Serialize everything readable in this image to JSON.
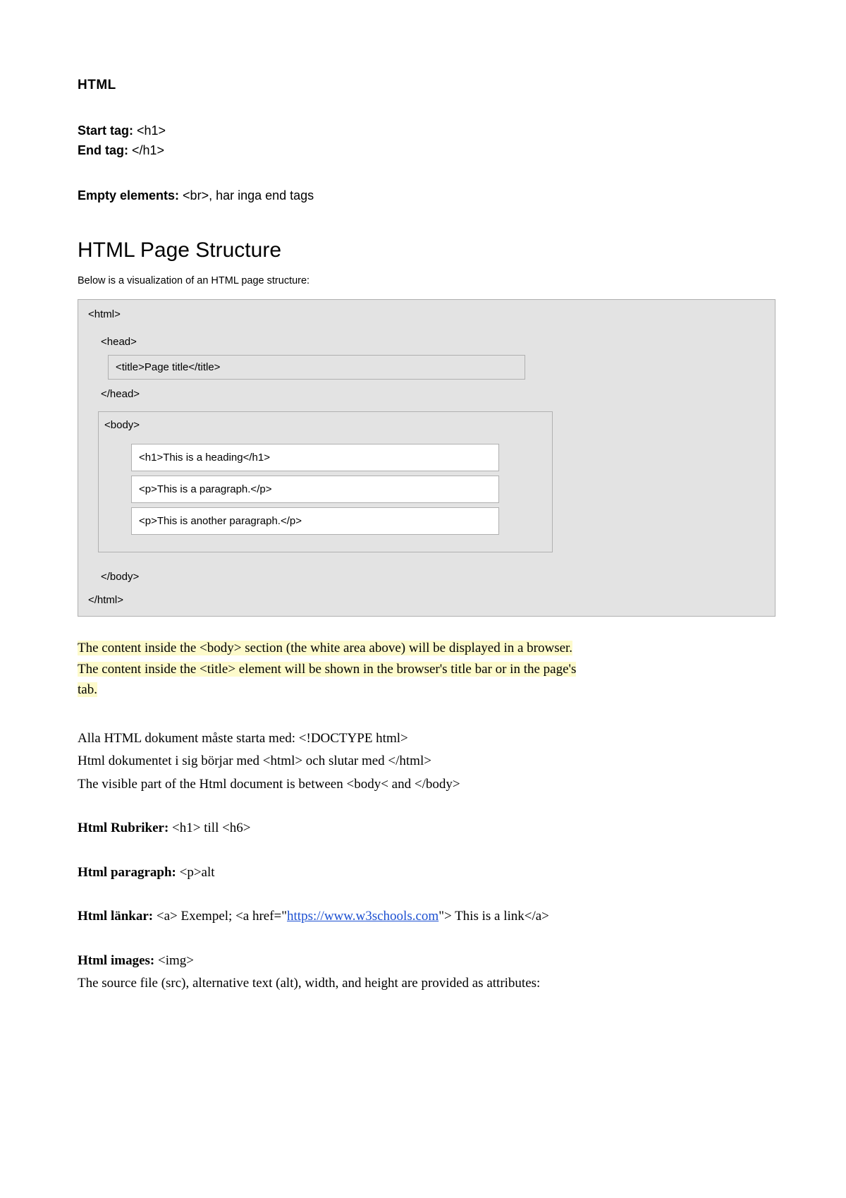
{
  "title": "HTML",
  "startTagLabel": "Start tag:",
  "startTagVal": " <h1>",
  "endTagLabel": "End tag:",
  "endTagVal": " </h1>",
  "emptyLabel": "Empty elements:",
  "emptyVal": " <br>, har inga end tags",
  "sectionTitle": "HTML Page Structure",
  "sectionSub": "Below is a visualization of an HTML page structure:",
  "struct": {
    "htmlOpen": "<html>",
    "headOpen": "<head>",
    "titleTag": "<title>Page title</title>",
    "headClose": "</head>",
    "bodyOpen": "<body>",
    "h1": "<h1>This is a heading</h1>",
    "p1": "<p>This is a paragraph.</p>",
    "p2": "<p>This is another paragraph.</p>",
    "bodyClose": "</body>",
    "htmlClose": "</html>"
  },
  "highlight1": "The content inside the <body> section (the white area above) will be displayed in a browser.",
  "highlight2a": "The content inside the <title> element will be shown in the browser's title bar or in the page's",
  "highlight2b": "tab.",
  "para1": "Alla HTML dokument måste starta med: <!DOCTYPE html>",
  "para2": "Html dokumentet i sig börjar med <html> och slutar med </html>",
  "para3": "The visible part of the Html document is between <body< and </body>",
  "rubrikerLabel": "Html Rubriker:",
  "rubrikerVal": " <h1> till <h6>",
  "paragraphLabel": "Html paragraph:",
  "paragraphVal": " <p>alt",
  "lankarLabel": "Html länkar:",
  "lankarValPre": " <a> Exempel; <a href=\"",
  "lankarLink": "https://www.w3schools.com",
  "lankarValPost": "\"> This is a link</a>",
  "imagesLabel": "Html images:",
  "imagesVal": " <img>",
  "imagesDesc": "The source file (src), alternative text (alt), width, and height are provided as attributes:"
}
